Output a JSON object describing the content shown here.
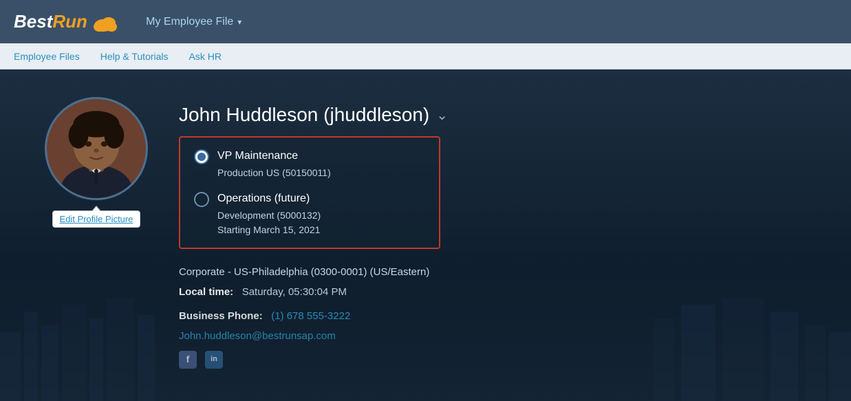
{
  "brand": {
    "name_bold": "Best",
    "name_light": "Run"
  },
  "top_nav": {
    "menu_item_label": "My Employee File",
    "dropdown_symbol": "▾"
  },
  "secondary_nav": {
    "items": [
      {
        "id": "employee-files",
        "label": "Employee Files"
      },
      {
        "id": "help-tutorials",
        "label": "Help & Tutorials"
      },
      {
        "id": "ask-hr",
        "label": "Ask HR"
      }
    ]
  },
  "employee": {
    "full_name": "John Huddleson (jhuddleson)",
    "chevron": "⌄",
    "edit_picture_label": "Edit Profile Picture",
    "roles": [
      {
        "id": "role-1",
        "title": "VP Maintenance",
        "detail1": "Production US (50150011)",
        "detail2": null,
        "detail3": null,
        "selected": true
      },
      {
        "id": "role-2",
        "title": "Operations (future)",
        "detail1": "Development (5000132)",
        "detail2": "Starting March 15, 2021",
        "detail3": null,
        "selected": false
      }
    ],
    "location": "Corporate - US-Philadelphia (0300-0001) (US/Eastern)",
    "local_time_label": "Local time:",
    "local_time_value": "Saturday, 05:30:04 PM",
    "business_phone_label": "Business Phone:",
    "business_phone_value": "(1) 678 555-3222",
    "email": "John.huddleson@bestrunsap.com",
    "social": {
      "facebook_symbol": "f",
      "linkedin_symbol": "in"
    }
  },
  "colors": {
    "accent_blue": "#2a9fd0",
    "nav_bg": "#3a5068",
    "body_bg": "#1a2a3a",
    "selected_radio": "#3a6a9a",
    "role_border": "#c0392b"
  }
}
